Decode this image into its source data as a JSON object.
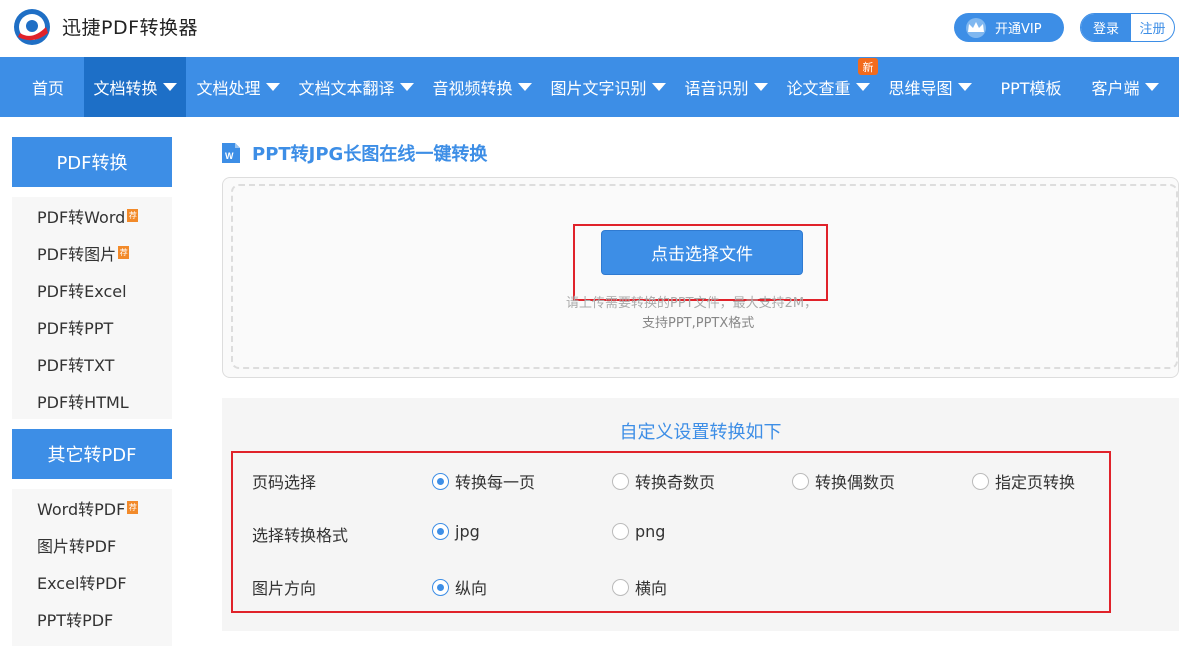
{
  "header": {
    "brand": "迅捷PDF转换器",
    "vip_label": "开通VIP",
    "login_label": "登录",
    "register_label": "注册"
  },
  "nav": {
    "items": [
      {
        "label": "首页",
        "dropdown": false
      },
      {
        "label": "文档转换",
        "dropdown": true,
        "active": true
      },
      {
        "label": "文档处理",
        "dropdown": true
      },
      {
        "label": "文档文本翻译",
        "dropdown": true
      },
      {
        "label": "音视频转换",
        "dropdown": true
      },
      {
        "label": "图片文字识别",
        "dropdown": true
      },
      {
        "label": "语音识别",
        "dropdown": true
      },
      {
        "label": "论文查重",
        "dropdown": true
      },
      {
        "label": "思维导图",
        "dropdown": true
      },
      {
        "label": "PPT模板",
        "dropdown": false
      },
      {
        "label": "客户端",
        "dropdown": true
      }
    ],
    "new_badge": "新"
  },
  "sidebar": {
    "group1": {
      "title": "PDF转换",
      "items": [
        "PDF转Word",
        "PDF转图片",
        "PDF转Excel",
        "PDF转PPT",
        "PDF转TXT",
        "PDF转HTML"
      ]
    },
    "group2": {
      "title": "其它转PDF",
      "items": [
        "Word转PDF",
        "图片转PDF",
        "Excel转PDF",
        "PPT转PDF"
      ]
    },
    "hot_badge": "荐"
  },
  "main": {
    "title": "PPT转JPG长图在线一键转换",
    "choose_button": "点击选择文件",
    "hint_line1": "请上传需要转换的PPT文件，最大支持2M，",
    "hint_line2": "支持PPT,PPTX格式"
  },
  "settings": {
    "title": "自定义设置转换如下",
    "rows": [
      {
        "label": "页码选择",
        "options": [
          "转换每一页",
          "转换奇数页",
          "转换偶数页",
          "指定页转换"
        ],
        "selected": "转换每一页"
      },
      {
        "label": "选择转换格式",
        "options": [
          "jpg",
          "png"
        ],
        "selected": "jpg"
      },
      {
        "label": "图片方向",
        "options": [
          "纵向",
          "横向"
        ],
        "selected": "纵向"
      }
    ]
  },
  "colors": {
    "accent": "#3d8ee6",
    "nav_active": "#1d6fc7",
    "highlight_border": "#e0222a",
    "badge_orange": "#f26b1d"
  }
}
